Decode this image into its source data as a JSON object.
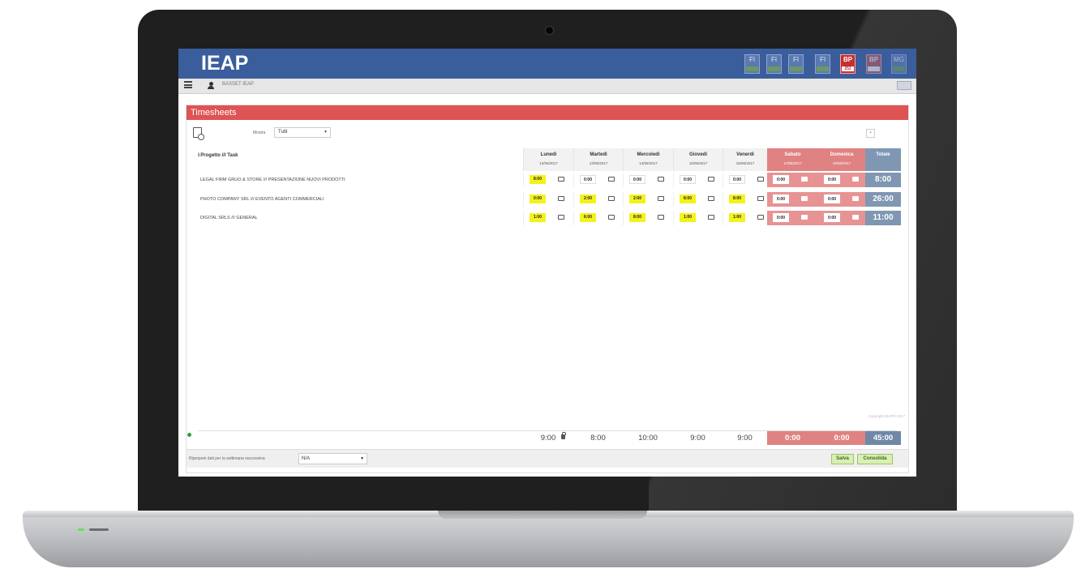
{
  "app": {
    "title": "IEAP",
    "modules": [
      "FI",
      "FI",
      "FI",
      "FI",
      "BP",
      "BP",
      "MG"
    ],
    "module_bp_sub": "252"
  },
  "toolbar": {
    "user": "BASSET IEAP"
  },
  "timesheet": {
    "title": "Timesheets",
    "filter_label": "Mostra",
    "filter_value": "Tutti",
    "task_column": "Progetto /// Task",
    "days": [
      {
        "name": "Lunedì",
        "date": "12/06/2017",
        "weekend": false
      },
      {
        "name": "Martedì",
        "date": "13/06/2017",
        "weekend": false
      },
      {
        "name": "Mercoledì",
        "date": "14/06/2017",
        "weekend": false
      },
      {
        "name": "Giovedì",
        "date": "15/06/2017",
        "weekend": false
      },
      {
        "name": "Venerdì",
        "date": "16/06/2017",
        "weekend": false
      },
      {
        "name": "Sabato",
        "date": "17/06/2017",
        "weekend": true
      },
      {
        "name": "Domenica",
        "date": "18/06/2017",
        "weekend": true
      }
    ],
    "total_label": "Totale",
    "rows": [
      {
        "label": "LEGAL FIRM GRUO & STORE /// PRESENTAZIONE NUOVI PRODOTTI",
        "values": [
          "8:00",
          "0:00",
          "0:00",
          "0:00",
          "0:00",
          "0:00",
          "0:00"
        ],
        "highlight": [
          true,
          false,
          false,
          false,
          false,
          false,
          false
        ],
        "total": "8:00"
      },
      {
        "label": "PHOTO COMPANY SRL /// EVENTO AGENTI COMMERCIALI",
        "values": [
          "0:00",
          "2:00",
          "2:00",
          "8:00",
          "8:00",
          "0:00",
          "0:00"
        ],
        "highlight": [
          true,
          true,
          true,
          true,
          true,
          false,
          false
        ],
        "total": "26:00"
      },
      {
        "label": "DIGITAL SRLS /// GENERAL",
        "values": [
          "1:00",
          "6:00",
          "8:00",
          "1:00",
          "1:00",
          "0:00",
          "0:00"
        ],
        "highlight": [
          true,
          true,
          true,
          true,
          true,
          false,
          false
        ],
        "total": "11:00"
      }
    ],
    "footer_totals": [
      "9:00",
      "8:00",
      "10:00",
      "9:00",
      "9:00",
      "0:00",
      "0:00"
    ],
    "footer_grand_total": "45:00",
    "copy_label": "Riproponi dati per la settimana successiva",
    "copy_select": "N/A",
    "save_label": "Salva",
    "submit_label": "Consolida",
    "copyright": "Copyright IEAP© 2017"
  },
  "colors": {
    "header": "#3a5d9c",
    "panel_title": "#de5353",
    "weekend": "#e08282",
    "total": "#7f97b2",
    "highlight": "#f4f21c"
  }
}
